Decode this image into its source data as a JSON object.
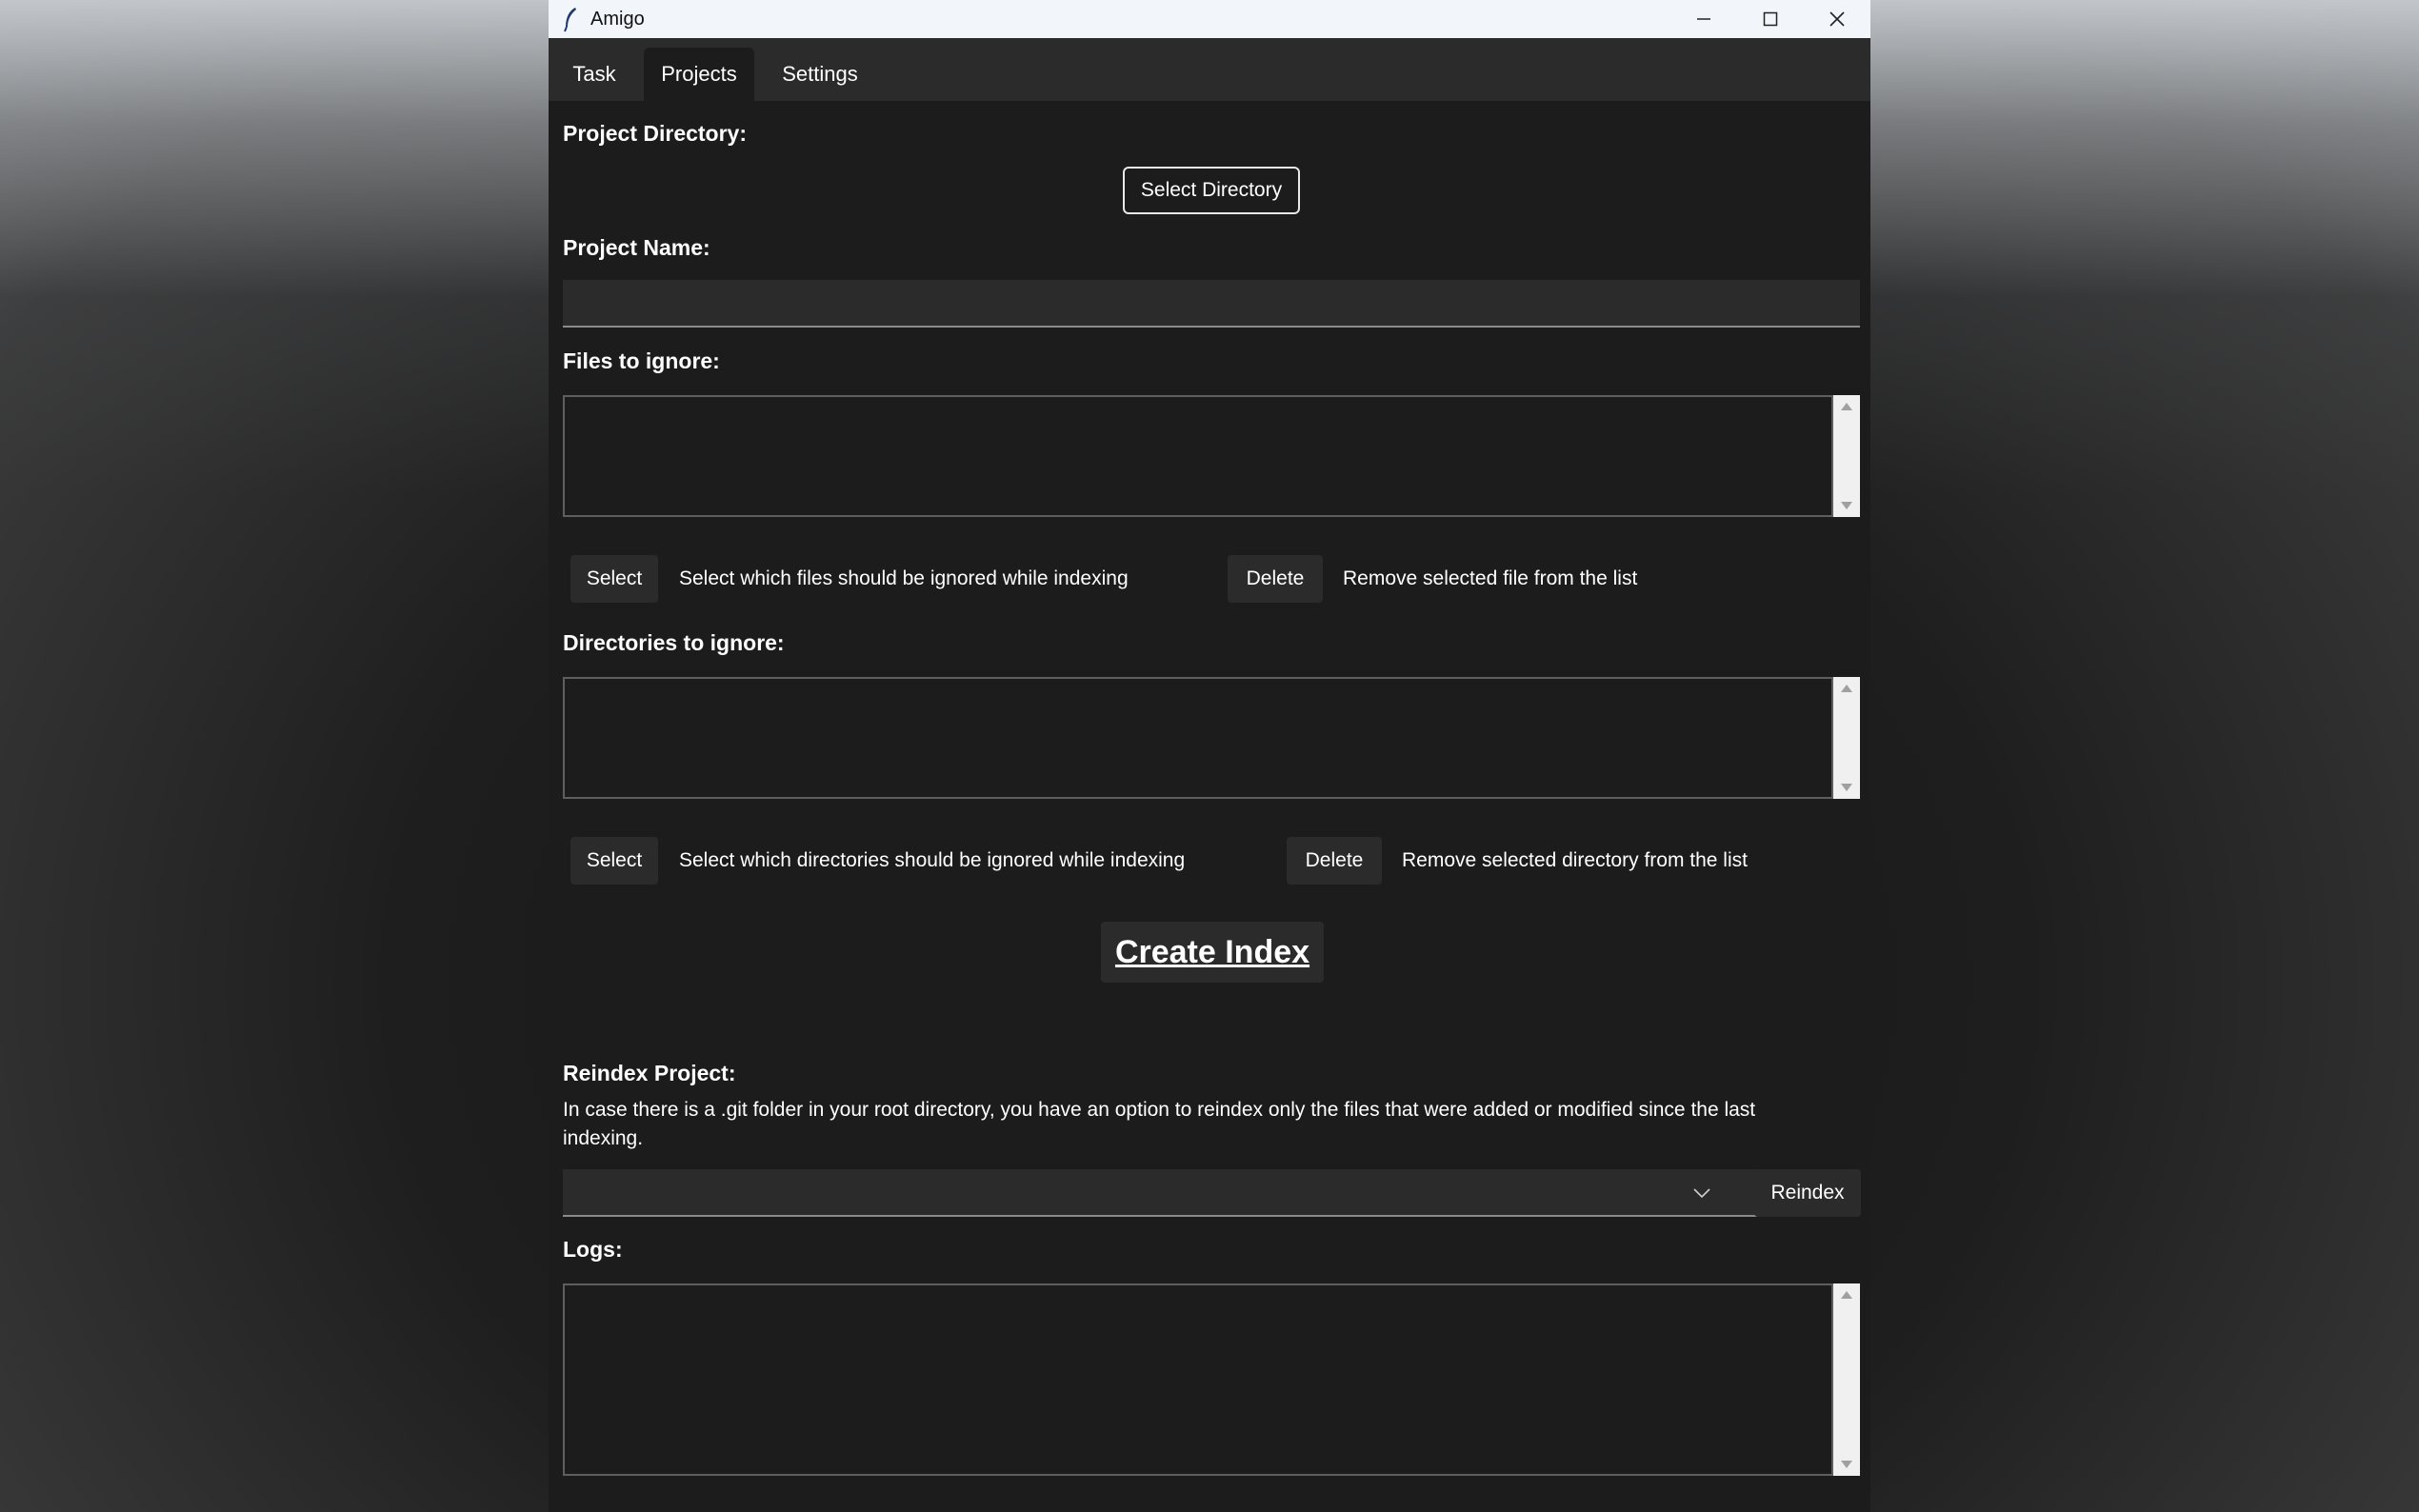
{
  "window": {
    "title": "Amigo",
    "icon": "feather-icon"
  },
  "window_controls": {
    "minimize": "minimize-icon",
    "maximize": "maximize-icon",
    "close": "close-icon"
  },
  "tabs": [
    {
      "label": "Task",
      "active": false
    },
    {
      "label": "Projects",
      "active": true
    },
    {
      "label": "Settings",
      "active": false
    }
  ],
  "project_directory": {
    "label": "Project Directory:",
    "button": "Select Directory"
  },
  "project_name": {
    "label": "Project Name:",
    "value": ""
  },
  "files_to_ignore": {
    "label": "Files to ignore:",
    "items": [],
    "select_button": "Select",
    "select_hint": "Select which files should be ignored while indexing",
    "delete_button": "Delete",
    "delete_hint": "Remove selected file from the list"
  },
  "directories_to_ignore": {
    "label": "Directories to ignore:",
    "items": [],
    "select_button": "Select",
    "select_hint": "Select which directories should be ignored while indexing",
    "delete_button": "Delete",
    "delete_hint": "Remove selected directory from the list"
  },
  "create_index": {
    "label": "Create Index"
  },
  "reindex": {
    "label": "Reindex Project:",
    "description": "In case there is a .git folder in your root directory, you have an option to reindex only the files that were added or modified since the last indexing.",
    "selected": "",
    "button": "Reindex"
  },
  "logs": {
    "label": "Logs:",
    "content": ""
  },
  "colors": {
    "window_bg": "#1c1c1c",
    "tabbar_bg": "#2b2b2b",
    "titlebar_bg": "#f2f5fa",
    "button_bg": "#2b2b2b"
  }
}
